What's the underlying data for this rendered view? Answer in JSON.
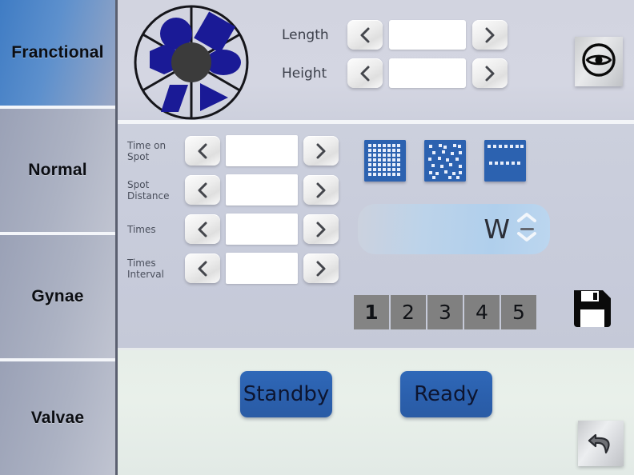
{
  "sidebar": {
    "tabs": [
      {
        "label": "Franctional",
        "selected": true
      },
      {
        "label": "Normal",
        "selected": false
      },
      {
        "label": "Gynae",
        "selected": false
      },
      {
        "label": "Valvae",
        "selected": false
      }
    ]
  },
  "top_panel": {
    "shape_wheel": {
      "icon": "shape-wheel-icon",
      "shapes": [
        "circle",
        "diamond",
        "ellipse",
        "triangle",
        "parallelogram",
        "hexagon"
      ],
      "shape_color": "#1a1a96",
      "hub_color": "#3b3b3b"
    },
    "fields": [
      {
        "label": "Length",
        "value": "",
        "placeholder": "",
        "dec_icon": "chevron-left-icon",
        "inc_icon": "chevron-right-icon"
      },
      {
        "label": "Height",
        "value": "",
        "placeholder": "",
        "dec_icon": "chevron-left-icon",
        "inc_icon": "chevron-right-icon"
      }
    ],
    "eye_button": {
      "icon": "eye-icon",
      "label": ""
    }
  },
  "middle_panel": {
    "params": [
      {
        "label": "Time on\nSpot",
        "label_line1": "Time on",
        "label_line2": "Spot",
        "value": ""
      },
      {
        "label": "Spot\nDistance",
        "label_line1": "Spot",
        "label_line2": "Distance",
        "value": ""
      },
      {
        "label": "Times",
        "label_line1": "Times",
        "label_line2": "",
        "value": ""
      },
      {
        "label": "Times\nInterval",
        "label_line1": "Times",
        "label_line2": "Interval",
        "value": ""
      }
    ],
    "patterns": [
      {
        "name": "dense-grid-pattern-icon",
        "selected": false
      },
      {
        "name": "scattered-dots-pattern-icon",
        "selected": false
      },
      {
        "name": "two-row-dots-pattern-icon",
        "selected": false
      }
    ],
    "power": {
      "value": "",
      "unit": "W",
      "up_icon": "chevron-up-icon",
      "down_icon": "chevron-down-icon",
      "divider_icon": "dash-icon"
    },
    "presets": [
      {
        "label": "1",
        "selected": true
      },
      {
        "label": "2",
        "selected": false
      },
      {
        "label": "3",
        "selected": false
      },
      {
        "label": "4",
        "selected": false
      },
      {
        "label": "5",
        "selected": false
      }
    ],
    "save_button": {
      "icon": "floppy-disk-save-icon",
      "label": ""
    }
  },
  "bottom_panel": {
    "standby_label": "Standby",
    "ready_label": "Ready",
    "back_button": {
      "icon": "back-arrow-icon",
      "label": ""
    }
  },
  "colors": {
    "accent_blue": "#2c62b0",
    "shape_blue": "#1a1a96",
    "selected_tab": "#3f7cc4",
    "preset_gray": "#808080",
    "panel_bg": "#cfd2de",
    "bottom_bg": "#e6eee8"
  }
}
